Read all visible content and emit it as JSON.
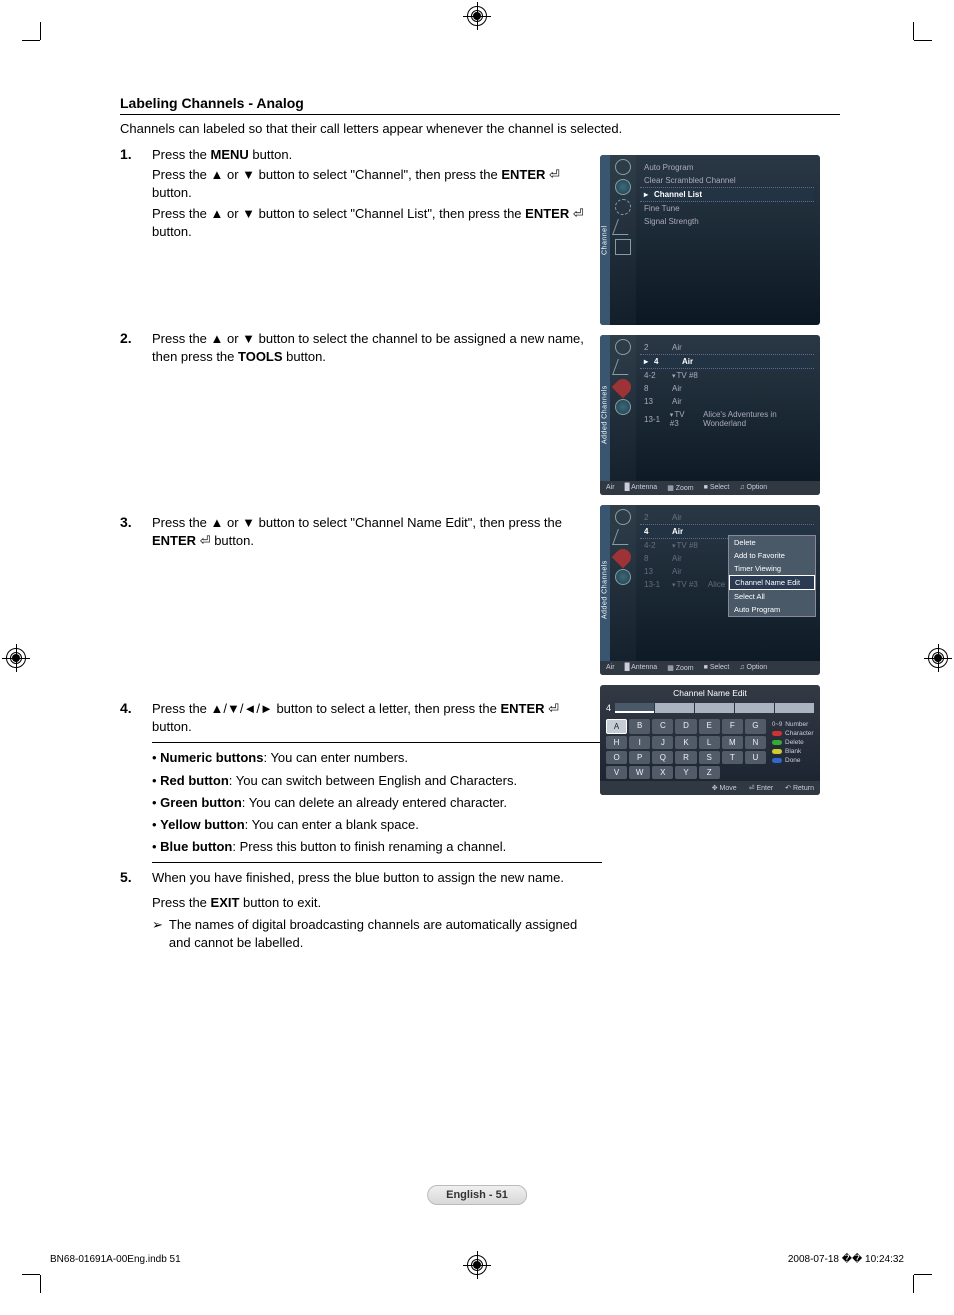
{
  "section_title": "Labeling Channels - Analog",
  "intro": "Channels can labeled so that their call letters appear whenever the channel is selected.",
  "steps": {
    "s1": {
      "num": "1.",
      "l1a": "Press the ",
      "l1b": "MENU",
      "l1c": " button.",
      "l2a": "Press the ▲ or ▼ button to select \"Channel\", then press the ",
      "l2b": "ENTER",
      "l2c": " button.",
      "l3a": "Press the ▲ or ▼ button to select \"Channel List\", then press the ",
      "l3b": "ENTER",
      "l3c": " button."
    },
    "s2": {
      "num": "2.",
      "l1a": "Press the ▲ or ▼ button to select the channel to be assigned a new name, then press the ",
      "l1b": "TOOLS",
      "l1c": " button."
    },
    "s3": {
      "num": "3.",
      "l1a": "Press the ▲ or ▼ button to select \"Channel Name Edit\", then press the ",
      "l1b": "ENTER",
      "l1c": " button."
    },
    "s4": {
      "num": "4.",
      "l1a": "Press the ▲/▼/◄/► button to select a letter, then press the ",
      "l1b": "ENTER",
      "l1c": " button.",
      "b1a": "Numeric buttons",
      "b1b": ": You can enter numbers.",
      "b2a": "Red button",
      "b2b": ": You can switch between English and Characters.",
      "b3a": "Green button",
      "b3b": ": You can delete an already entered character.",
      "b4a": "Yellow button",
      "b4b": ": You can enter a blank space.",
      "b5a": "Blue button",
      "b5b": ": Press this button to finish renaming a channel."
    },
    "s5": {
      "num": "5.",
      "l1": "When you have finished, press the blue button to assign the new name.",
      "l2a": "Press the ",
      "l2b": "EXIT",
      "l2c": " button to exit.",
      "note": "The names of digital broadcasting channels are automatically assigned and cannot be labelled."
    }
  },
  "osd1": {
    "side": "Channel",
    "items": [
      "Auto Program",
      "Clear Scrambled Channel",
      "Channel List",
      "Fine Tune",
      "Signal Strength"
    ]
  },
  "osd2": {
    "side": "Added Channels",
    "rows": [
      {
        "ch": "2",
        "name": "Air",
        "desc": ""
      },
      {
        "ch": "4",
        "name": "Air",
        "desc": ""
      },
      {
        "ch": "4-2",
        "name": "TV #8",
        "desc": "",
        "dtv": true
      },
      {
        "ch": "8",
        "name": "Air",
        "desc": ""
      },
      {
        "ch": "13",
        "name": "Air",
        "desc": ""
      },
      {
        "ch": "13-1",
        "name": "TV #3",
        "desc": "Alice's Adventures in Wonderland",
        "dtv": true
      }
    ],
    "hl_index": 1,
    "footer": {
      "air": "Air",
      "ant": "Antenna",
      "zoom": "Zoom",
      "select": "Select",
      "option": "Option"
    }
  },
  "osd3": {
    "side": "Added Channels",
    "rows": [
      {
        "ch": "2",
        "name": "Air"
      },
      {
        "ch": "4",
        "name": "Air"
      },
      {
        "ch": "4-2",
        "name": "TV #8",
        "dtv": true
      },
      {
        "ch": "8",
        "name": "Air"
      },
      {
        "ch": "13",
        "name": "Air"
      },
      {
        "ch": "13-1",
        "name": "TV #3",
        "desc": "Alice",
        "dtv": true
      }
    ],
    "hl_index": 1,
    "popup": [
      "Delete",
      "Add to Favorite",
      "Timer Viewing",
      "Channel Name Edit",
      "Select All",
      "Auto Program"
    ],
    "popup_sel": 3,
    "footer": {
      "air": "Air",
      "ant": "Antenna",
      "zoom": "Zoom",
      "select": "Select",
      "option": "Option"
    }
  },
  "osd4": {
    "title": "Channel Name Edit",
    "channel": "4",
    "keys": [
      "A",
      "B",
      "C",
      "D",
      "E",
      "F",
      "G",
      "H",
      "I",
      "J",
      "K",
      "L",
      "M",
      "N",
      "O",
      "P",
      "Q",
      "R",
      "S",
      "T",
      "U",
      "V",
      "W",
      "X",
      "Y",
      "Z"
    ],
    "sel_key": 0,
    "legend": [
      {
        "color": "gray",
        "label": "Number",
        "prefix": "0~9"
      },
      {
        "color": "red",
        "label": "Character"
      },
      {
        "color": "green",
        "label": "Delete"
      },
      {
        "color": "yellow",
        "label": "Blank"
      },
      {
        "color": "blue",
        "label": "Done"
      }
    ],
    "footer": {
      "move": "Move",
      "enter": "Enter",
      "return": "Return"
    }
  },
  "page_badge": "English - 51",
  "footer_left": "BN68-01691A-00Eng.indb   51",
  "footer_right": "2008-07-18   �� 10:24:32",
  "enter_glyph": "⏎"
}
